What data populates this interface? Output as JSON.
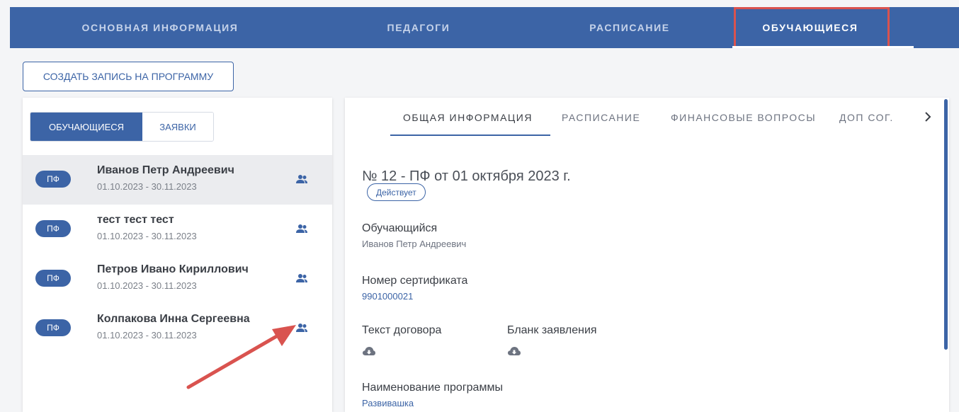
{
  "top_tabs": [
    {
      "label": "ОСНОВНАЯ ИНФОРМАЦИЯ"
    },
    {
      "label": "ПЕДАГОГИ"
    },
    {
      "label": "РАСПИСАНИЕ"
    },
    {
      "label": "ОБУЧАЮЩИЕСЯ",
      "active": true
    }
  ],
  "create_button": "СОЗДАТЬ ЗАПИСЬ НА ПРОГРАММУ",
  "left_tabs": [
    "ОБУЧАЮЩИЕСЯ",
    "ЗАЯВКИ"
  ],
  "students": [
    {
      "badge": "ПФ",
      "name": "Иванов Петр Андреевич",
      "dates": "01.10.2023 - 30.11.2023",
      "icon": "group-icon"
    },
    {
      "badge": "ПФ",
      "name": "тест тест тест",
      "dates": "01.10.2023 - 30.11.2023",
      "icon": "group-icon"
    },
    {
      "badge": "ПФ",
      "name": "Петров Ивано Кириллович",
      "dates": "01.10.2023 - 30.11.2023",
      "icon": "group-icon"
    },
    {
      "badge": "ПФ",
      "name": "Колпакова Инна Сергеевна",
      "dates": "01.10.2023 - 30.11.2023",
      "icon": "group-icon"
    }
  ],
  "sub_tabs": [
    "ОБЩАЯ ИНФОРМАЦИЯ",
    "РАСПИСАНИЕ",
    "ФИНАНСОВЫЕ ВОПРОСЫ",
    "ДОП СОГ."
  ],
  "contract": {
    "title": "№ 12 - ПФ от 01 октября 2023 г.",
    "status": "Действует",
    "student_label": "Обучающийся",
    "student_value": "Иванов Петр Андреевич",
    "certificate_label": "Номер сертификата",
    "certificate_value": "9901000021",
    "contract_text_label": "Текст договора",
    "application_form_label": "Бланк заявления",
    "program_label": "Наименование программы",
    "program_value": "Развивашка"
  },
  "colors": {
    "primary": "#3c64a6",
    "highlight": "#d9534f",
    "annotation_arrow": "#d9534f",
    "selected_row": "#ebecef"
  },
  "icons": {
    "download": "cloud-download-icon",
    "next": "chevron-right-icon",
    "group": "group-icon"
  }
}
